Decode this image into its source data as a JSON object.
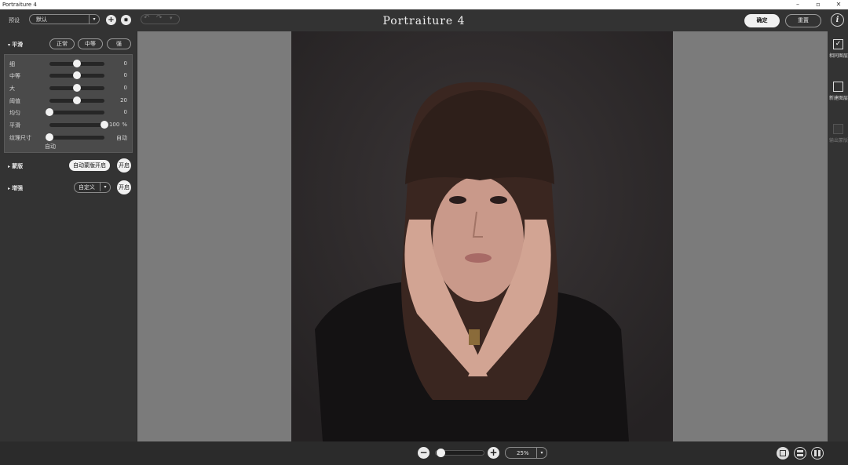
{
  "window": {
    "title": "Portraiture 4",
    "minimize": "–",
    "restore": "▫",
    "close": "✕"
  },
  "toolbar": {
    "preset_label": "预设",
    "preset_value": "默认",
    "add_icon": "+",
    "settings_icon": "✸",
    "app_title": "Portraiture 4",
    "ok_label": "确定",
    "reset_label": "重置",
    "info_icon": "i"
  },
  "smoothing": {
    "title": "平滑",
    "presets": [
      "正常",
      "中等",
      "强"
    ],
    "sliders": [
      {
        "name": "细",
        "value": "0",
        "unit": "",
        "level": 0.5
      },
      {
        "name": "中等",
        "value": "0",
        "unit": "",
        "level": 0.5
      },
      {
        "name": "大",
        "value": "0",
        "unit": "",
        "level": 0.5
      },
      {
        "name": "阈值",
        "value": "20",
        "unit": "",
        "level": 0.5
      },
      {
        "name": "均匀",
        "value": "0",
        "unit": "",
        "level": 0.0
      },
      {
        "name": "平滑",
        "value": "100",
        "unit": "%",
        "level": 1.0
      },
      {
        "name": "纹理尺寸",
        "value": "自动",
        "unit": "",
        "level": 0.0
      }
    ],
    "size_caption": "自动"
  },
  "mask": {
    "title": "蒙版",
    "auto_button": "自动蒙版开启",
    "toggle": "开启"
  },
  "enhance": {
    "title": "增强",
    "mode": "自定义",
    "toggle": "开启"
  },
  "right_panel": {
    "same_layer": "相同图层",
    "new_layer": "新建图层",
    "output_mask": "输出蒙版"
  },
  "zoom": {
    "value": "25%",
    "minus": "−",
    "plus": "+",
    "level": 0.1
  },
  "colors": {
    "panel": "#333333",
    "canvas": "#7b7b7b",
    "accent": "#f1f1f1"
  }
}
